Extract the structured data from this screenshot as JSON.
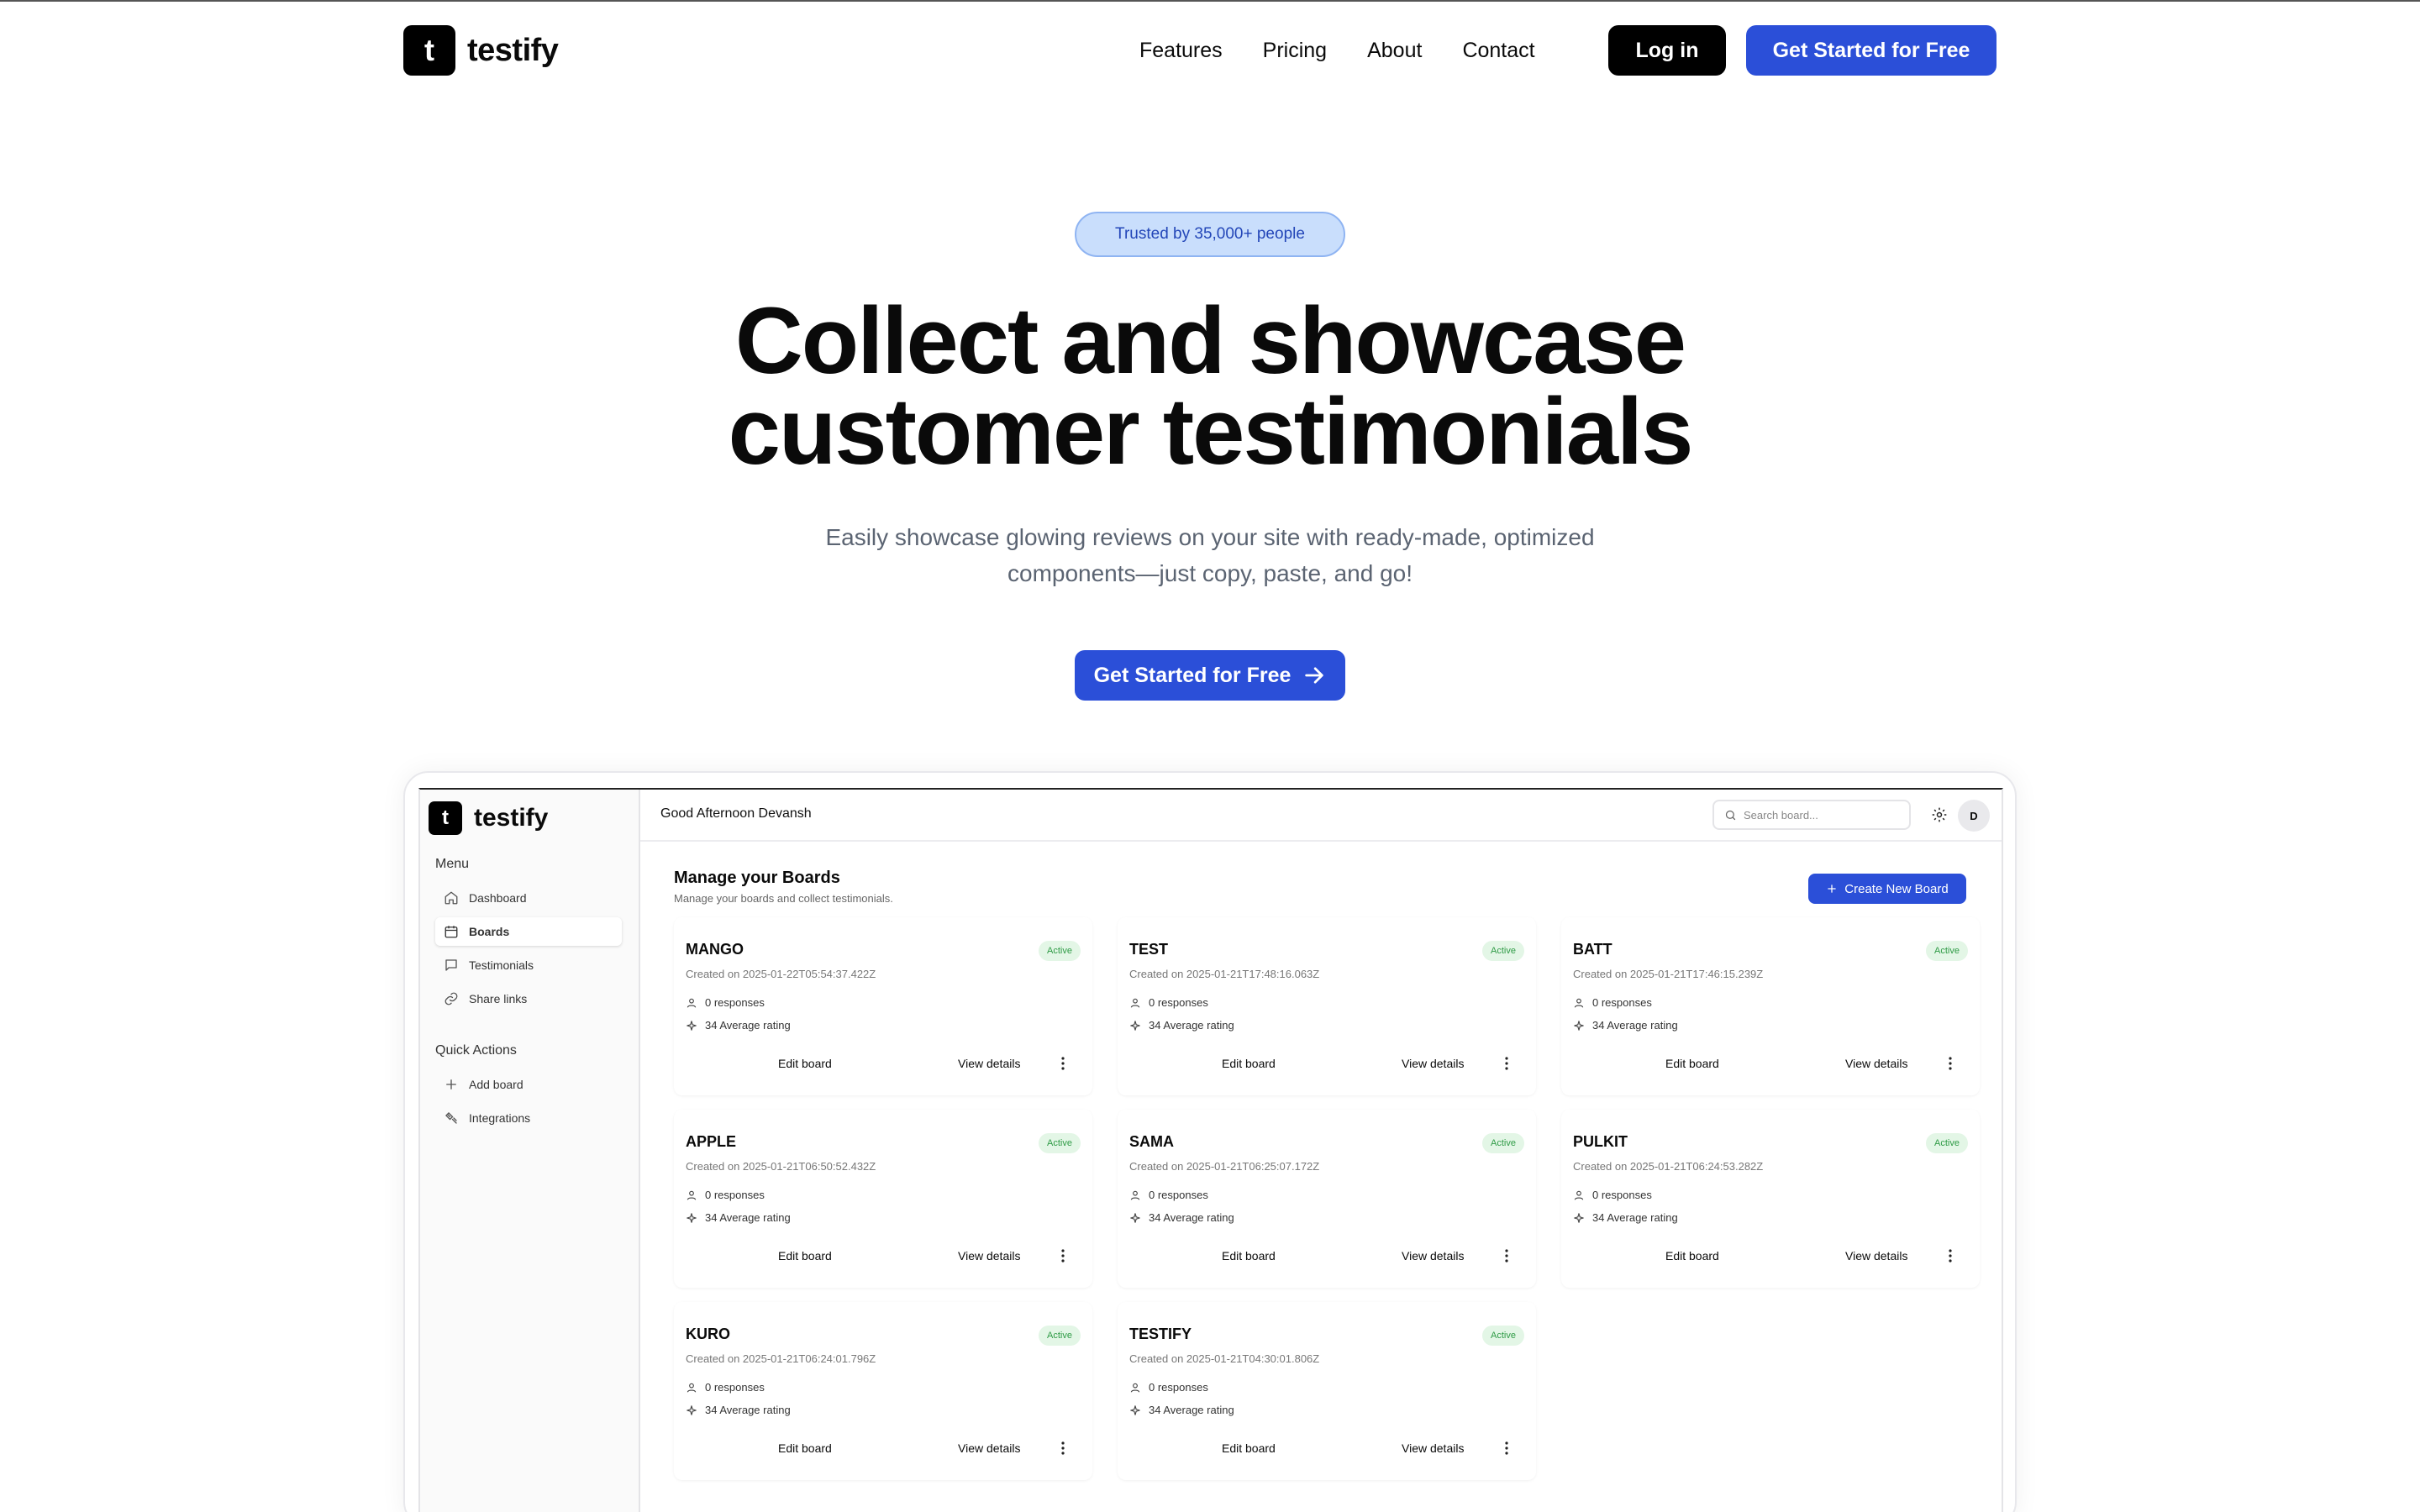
{
  "brand": {
    "logo_letter": "t",
    "name": "testify"
  },
  "nav": {
    "links": [
      "Features",
      "Pricing",
      "About",
      "Contact"
    ],
    "login_label": "Log in",
    "cta_label": "Get Started for Free",
    "accent_color": "#2b4fd8"
  },
  "hero": {
    "badge": "Trusted by 35,000+ people",
    "title_line1": "Collect and showcase",
    "title_line2": "customer testimonials",
    "subtitle_line1": "Easily showcase glowing reviews on your site with ready-made, optimized",
    "subtitle_line2": "components—just copy, paste, and go!",
    "cta_label": "Get Started for Free"
  },
  "app": {
    "sidebar": {
      "menu_heading": "Menu",
      "menu_items": [
        {
          "label": "Dashboard",
          "icon": "home-icon"
        },
        {
          "label": "Boards",
          "icon": "calendar-icon",
          "active": true
        },
        {
          "label": "Testimonials",
          "icon": "message-icon"
        },
        {
          "label": "Share links",
          "icon": "link-icon"
        }
      ],
      "quick_heading": "Quick Actions",
      "quick_items": [
        {
          "label": "Add board",
          "icon": "plus-icon"
        },
        {
          "label": "Integrations",
          "icon": "plug-icon"
        }
      ]
    },
    "topbar": {
      "greeting": "Good Afternoon Devansh",
      "search_placeholder": "Search board...",
      "avatar_initial": "D"
    },
    "page": {
      "title": "Manage your Boards",
      "subtitle": "Manage your boards and collect testimonials.",
      "create_label": "Create New Board"
    },
    "card_labels": {
      "edit": "Edit board",
      "view": "View details"
    },
    "boards": [
      {
        "name": "MANGO",
        "status": "Active",
        "created": "Created on 2025-01-22T05:54:37.422Z",
        "responses": "0 responses",
        "rating": "34 Average rating"
      },
      {
        "name": "TEST",
        "status": "Active",
        "created": "Created on 2025-01-21T17:48:16.063Z",
        "responses": "0 responses",
        "rating": "34 Average rating"
      },
      {
        "name": "BATT",
        "status": "Active",
        "created": "Created on 2025-01-21T17:46:15.239Z",
        "responses": "0 responses",
        "rating": "34 Average rating"
      },
      {
        "name": "APPLE",
        "status": "Active",
        "created": "Created on 2025-01-21T06:50:52.432Z",
        "responses": "0 responses",
        "rating": "34 Average rating"
      },
      {
        "name": "SAMA",
        "status": "Active",
        "created": "Created on 2025-01-21T06:25:07.172Z",
        "responses": "0 responses",
        "rating": "34 Average rating"
      },
      {
        "name": "PULKIT",
        "status": "Active",
        "created": "Created on 2025-01-21T06:24:53.282Z",
        "responses": "0 responses",
        "rating": "34 Average rating"
      },
      {
        "name": "KURO",
        "status": "Active",
        "created": "Created on 2025-01-21T06:24:01.796Z",
        "responses": "0 responses",
        "rating": "34 Average rating"
      },
      {
        "name": "TESTIFY",
        "status": "Active",
        "created": "Created on 2025-01-21T04:30:01.806Z",
        "responses": "0 responses",
        "rating": "34 Average rating"
      }
    ]
  }
}
